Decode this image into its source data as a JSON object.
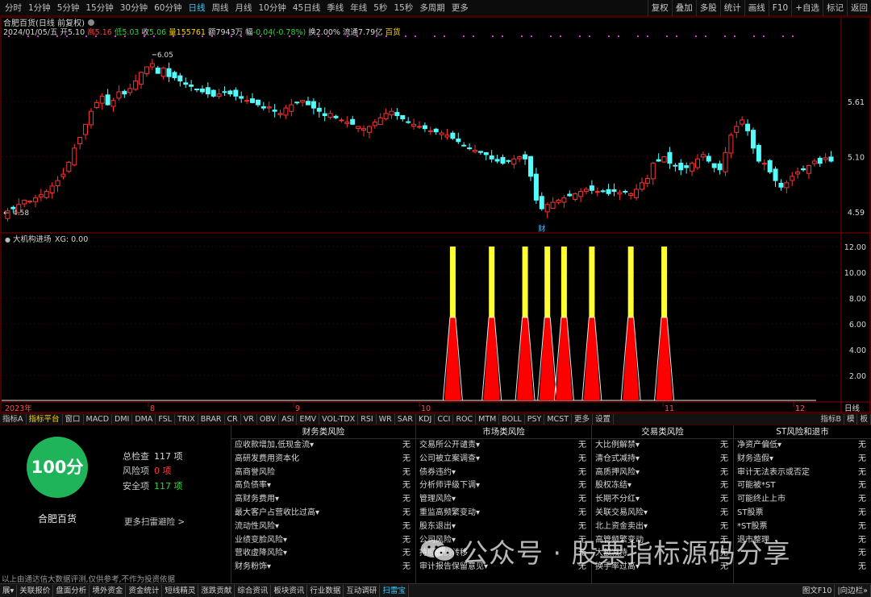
{
  "toolbar": {
    "timeframes": [
      "分时",
      "1分钟",
      "5分钟",
      "15分钟",
      "30分钟",
      "60分钟",
      "日线",
      "周线",
      "月线",
      "10分钟",
      "45日线",
      "季线",
      "年线",
      "5秒",
      "15秒",
      "多周期",
      "更多"
    ],
    "active_timeframe": "日线",
    "right_buttons": [
      "复权",
      "叠加",
      "多股",
      "统计",
      "画线",
      "F10",
      "+自选",
      "标记",
      "返回"
    ]
  },
  "stock": {
    "title": "合肥百货(日线 前复权)",
    "date": "2024/01/05/五",
    "open_label": "开",
    "open": "5.10",
    "high_label": "高",
    "high": "5.16",
    "low_label": "低",
    "low": "5.03",
    "close_label": "收",
    "close": "5.06",
    "volume_label": "量",
    "volume": "155761",
    "amount_label": "额",
    "amount": "7943万",
    "change_label": "幅",
    "change": "-0.04(-0.78%)",
    "turnover_label": "换",
    "turnover": "2.00%",
    "float_label": "流通",
    "float_cap": "7.79亿",
    "sector": "百货"
  },
  "price_axis": {
    "labels": [
      "5.61",
      "5.10",
      "4.59"
    ],
    "high_marker": "6.05",
    "low_marker": "4.58",
    "ymin": 4.45,
    "ymax": 6.25
  },
  "event_marker": "财",
  "indicator": {
    "title": "大机构进场",
    "value_label": "XG: 0.00",
    "axis": [
      "12.00",
      "10.00",
      "8.00",
      "6.00",
      "4.00",
      "2.00"
    ],
    "signal_candle_indices": [
      80,
      87,
      93,
      97,
      100,
      105,
      112,
      118
    ]
  },
  "time_axis": {
    "labels": [
      "2023年",
      "8",
      "9",
      "10",
      "11",
      "12",
      "1"
    ],
    "right_label": "日线"
  },
  "chart_data": {
    "type": "candlestick",
    "title": "合肥百货(日线 前复权)",
    "x_labels": [
      "2023年",
      "8",
      "9",
      "10",
      "11",
      "12",
      "1"
    ],
    "y_ticks": [
      "5.61",
      "5.10",
      "4.59"
    ],
    "ylim": [
      4.45,
      6.25
    ],
    "colors": {
      "up": "#ff3232",
      "down": "#54fcfc",
      "background": "#000000"
    },
    "close_path": [
      4.6,
      4.62,
      4.66,
      4.7,
      4.69,
      4.72,
      4.75,
      4.78,
      4.83,
      4.88,
      4.94,
      5.05,
      5.18,
      5.28,
      5.4,
      5.52,
      5.6,
      5.66,
      5.58,
      5.62,
      5.7,
      5.68,
      5.73,
      5.8,
      5.88,
      5.93,
      5.96,
      5.87,
      5.92,
      5.84,
      5.83,
      5.8,
      5.77,
      5.75,
      5.72,
      5.7,
      5.68,
      5.66,
      5.68,
      5.7,
      5.68,
      5.66,
      5.64,
      5.62,
      5.6,
      5.58,
      5.55,
      5.56,
      5.52,
      5.5,
      5.55,
      5.58,
      5.6,
      5.62,
      5.58,
      5.55,
      5.52,
      5.48,
      5.5,
      5.46,
      5.44,
      5.42,
      5.4,
      5.38,
      5.36,
      5.38,
      5.42,
      5.46,
      5.5,
      5.52,
      5.48,
      5.45,
      5.42,
      5.4,
      5.38,
      5.36,
      5.34,
      5.33,
      5.32,
      5.3,
      5.27,
      5.24,
      5.2,
      5.18,
      5.16,
      5.14,
      5.12,
      5.08,
      5.06,
      5.04,
      5.06,
      5.08,
      5.1,
      5.08,
      4.92,
      4.7,
      4.62,
      4.66,
      4.68,
      4.7,
      4.72,
      4.74,
      4.76,
      4.78,
      4.8,
      4.79,
      4.78,
      4.78,
      4.76,
      4.78,
      4.77,
      4.78,
      4.76,
      4.8,
      4.86,
      4.9,
      5.04,
      5.06,
      5.1,
      5.04,
      5.02,
      4.98,
      5.0,
      5.04,
      5.08,
      5.12,
      5.06,
      5.0,
      4.98,
      5.14,
      5.3,
      5.38,
      5.44,
      5.34,
      5.18,
      5.06,
      5.04,
      4.96,
      4.88,
      4.82,
      4.86,
      4.92,
      4.96,
      4.98,
      5.02,
      5.06,
      5.04,
      5.09,
      5.06
    ],
    "indicator_signals": [
      {
        "candle": 80,
        "yellow_top": 12.0,
        "red_top": 6.5
      },
      {
        "candle": 87,
        "yellow_top": 12.0,
        "red_top": 6.5
      },
      {
        "candle": 93,
        "yellow_top": 12.0,
        "red_top": 6.5
      },
      {
        "candle": 97,
        "yellow_top": 12.0,
        "red_top": 6.5
      },
      {
        "candle": 100,
        "yellow_top": 12.0,
        "red_top": 6.5
      },
      {
        "candle": 105,
        "yellow_top": 12.0,
        "red_top": 6.5
      },
      {
        "candle": 112,
        "yellow_top": 12.0,
        "red_top": 6.5
      },
      {
        "candle": 118,
        "yellow_top": 12.0,
        "red_top": 6.5
      }
    ],
    "indicator_ylim": [
      0,
      13
    ]
  },
  "indicator_tabs": [
    "指标A",
    "指标平台",
    "窗口",
    "MACD",
    "DMI",
    "DMA",
    "FSL",
    "TRIX",
    "BRAR",
    "CR",
    "VR",
    "OBV",
    "ASI",
    "EMV",
    "VOL-TDX",
    "RSI",
    "WR",
    "SAR",
    "KDJ",
    "CCI",
    "ROC",
    "MTM",
    "BOLL",
    "PSY",
    "MCST",
    "更多",
    "设置"
  ],
  "active_indicator_tab": "指标平台",
  "indicator_right": [
    "指标B",
    "模",
    "板"
  ],
  "score": {
    "value": "100分",
    "company": "合肥百货",
    "total_label": "总检查",
    "total_value": "117 项",
    "risk_label": "风险项",
    "risk_value": "0 项",
    "safe_label": "安全项",
    "safe_value": "117 项",
    "more_link": "更多扫雷避险 >"
  },
  "risk_columns": [
    {
      "title": "财务类风险",
      "items": [
        {
          "label": "应收款增加,低现金流▾",
          "status": "无"
        },
        {
          "label": "高研发费用资本化",
          "status": "无"
        },
        {
          "label": "高商誉风险",
          "status": "无"
        },
        {
          "label": "高负债率▾",
          "status": "无"
        },
        {
          "label": "高财务费用▾",
          "status": "无"
        },
        {
          "label": "最大客户占营收比过高▾",
          "status": "无"
        },
        {
          "label": "流动性风险▾",
          "status": "无"
        },
        {
          "label": "业绩变脸风险▾",
          "status": "无"
        },
        {
          "label": "营收虚降风险▾",
          "status": "无"
        },
        {
          "label": "财务粉饰▾",
          "status": "无"
        }
      ]
    },
    {
      "title": "市场类风险",
      "items": [
        {
          "label": "交易所公开谴责▾",
          "status": "无"
        },
        {
          "label": "公司被立案调查▾",
          "status": "无"
        },
        {
          "label": "债券违约▾",
          "status": "无"
        },
        {
          "label": "分析师评级下调▾",
          "status": "无"
        },
        {
          "label": "管理风险▾",
          "status": "无"
        },
        {
          "label": "重监高频繁变动▾",
          "status": "无"
        },
        {
          "label": "股东退出▾",
          "status": "无"
        },
        {
          "label": "公司风险▾",
          "status": "无"
        },
        {
          "label": "持股比例转移",
          "status": "无"
        },
        {
          "label": "审计报告保留意见▾",
          "status": "无"
        }
      ]
    },
    {
      "title": "交易类风险",
      "items": [
        {
          "label": "大比例解禁▾",
          "status": "无"
        },
        {
          "label": "清仓式减持▾",
          "status": "无"
        },
        {
          "label": "高质押风险▾",
          "status": "无"
        },
        {
          "label": "股权冻结▾",
          "status": "无"
        },
        {
          "label": "长期不分红▾",
          "status": "无"
        },
        {
          "label": "关联交易风险▾",
          "status": "无"
        },
        {
          "label": "北上资金卖出▾",
          "status": "无"
        },
        {
          "label": "高管频繁变动",
          "status": "无"
        },
        {
          "label": "大额减持",
          "status": "无"
        },
        {
          "label": "换手率过高▾",
          "status": "无"
        }
      ]
    },
    {
      "title": "ST风险和退市",
      "items": [
        {
          "label": "净资产偏低▾",
          "status": "无"
        },
        {
          "label": "财务造假▾",
          "status": "无"
        },
        {
          "label": "审计无法表示或否定",
          "status": "无"
        },
        {
          "label": "可能被*ST",
          "status": "无"
        },
        {
          "label": "可能终止上市",
          "status": "无"
        },
        {
          "label": "ST股票",
          "status": "无"
        },
        {
          "label": "*ST股票",
          "status": "无"
        },
        {
          "label": "退市整理",
          "status": "无"
        },
        {
          "label": "",
          "status": "无"
        },
        {
          "label": "",
          "status": "无"
        }
      ]
    }
  ],
  "watermark": "公众号 · 股票指标源码分享",
  "disclaimer": "以上由通达信大数据评测,仅供参考,不作为投资依据",
  "status_bar": {
    "items": [
      "展▾",
      "关联报价",
      "盘面分析",
      "境外资金",
      "资金统计",
      "短线精灵",
      "涨跌贡献",
      "综合资讯",
      "板块资讯",
      "行业数据",
      "互动调研",
      "扫雷宝"
    ],
    "active": "扫雷宝",
    "right": [
      "图文F10",
      "|向边栏»"
    ]
  },
  "colors": {
    "up": "#ff3232",
    "down": "#54fcfc",
    "signal_yellow": "#ffff32",
    "signal_red": "#ff0000",
    "score_green": "#1fb35a",
    "frame": "#8a0000"
  }
}
